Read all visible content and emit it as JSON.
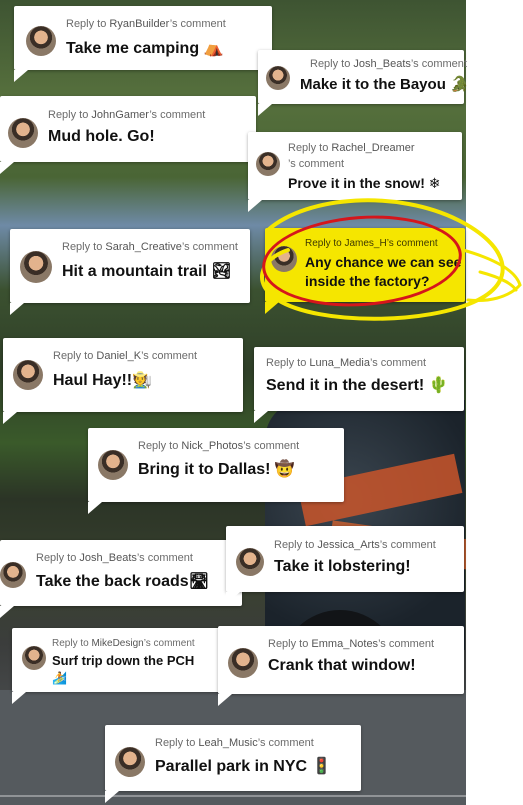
{
  "reply_prefix": "Reply to",
  "comment_suffix": "’s comment",
  "comments": [
    {
      "user": "RyanBuilder",
      "text": "Take me camping ⛺"
    },
    {
      "user": "Josh_Beats",
      "text": "Make it to the Bayou 🐊"
    },
    {
      "user": "JohnGamer",
      "text": "Mud hole. Go!"
    },
    {
      "user": "Rachel_Dreamer",
      "text": "Prove it in the snow! ❄"
    },
    {
      "user": "Sarah_Creative",
      "text": "Hit a mountain trail 🏞"
    },
    {
      "user": "James_H",
      "text_line1": "Any chance we can see",
      "text_line2": "inside the factory?"
    },
    {
      "user": "Daniel_K",
      "text": "Haul Hay!!🧑‍🌾"
    },
    {
      "user": "Luna_Media",
      "text": "Send it in the desert! 🌵"
    },
    {
      "user": "Nick_Photos",
      "text": "Bring it to Dallas! 🤠"
    },
    {
      "user": "Josh_Beats",
      "text": "Take the back roads🛣"
    },
    {
      "user": "Jessica_Arts",
      "text": "Take it lobstering!"
    },
    {
      "user": "MikeDesign",
      "text_line1": "Surf trip down the PCH",
      "text_line2": "🏄"
    },
    {
      "user": "Emma_Notes",
      "text": "Crank that window!"
    },
    {
      "user": "Leah_Music",
      "text": "Parallel park in NYC 🚦"
    }
  ],
  "colors": {
    "highlight_card": "#f5e600",
    "circle_annotation": "#d5161b",
    "scribble_annotation": "#f5e600"
  }
}
